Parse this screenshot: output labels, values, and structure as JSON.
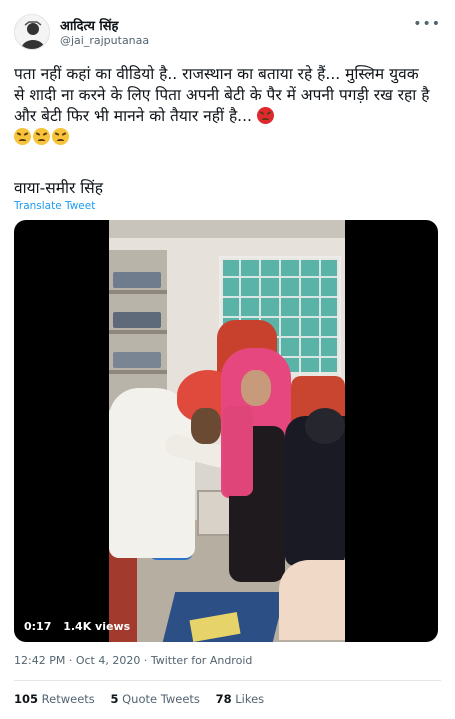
{
  "header": {
    "name": "आदित्य सिंह",
    "handle": "@jai_rajputanaa",
    "more": "•••"
  },
  "tweet": {
    "text": "पता नहीं कहां का वीडियो है.. राजस्थान का बताया रहे हैं... मुस्लिम युवक से शादी ना करने के लिए पिता अपनी बेटी के पैर में अपनी पगड़ी रख रहा है और बेटी फिर भी मानने को तैयार नहीं है...",
    "emojis": [
      "angry-face-icon",
      "tired-face-icon",
      "tired-face-icon",
      "tired-face-icon"
    ],
    "via": "वाया-समीर सिंह",
    "translate": "Translate Tweet"
  },
  "video": {
    "time": "0:17",
    "views": "1.4K views"
  },
  "meta": {
    "time": "12:42 PM",
    "date": "Oct 4, 2020",
    "source": "Twitter for Android",
    "separator": "·"
  },
  "stats": {
    "retweets_count": "105",
    "retweets_label": "Retweets",
    "quotes_count": "5",
    "quotes_label": "Quote Tweets",
    "likes_count": "78",
    "likes_label": "Likes"
  },
  "colors": {
    "link": "#1d9bf0",
    "muted": "#536471",
    "text": "#0f1419"
  }
}
